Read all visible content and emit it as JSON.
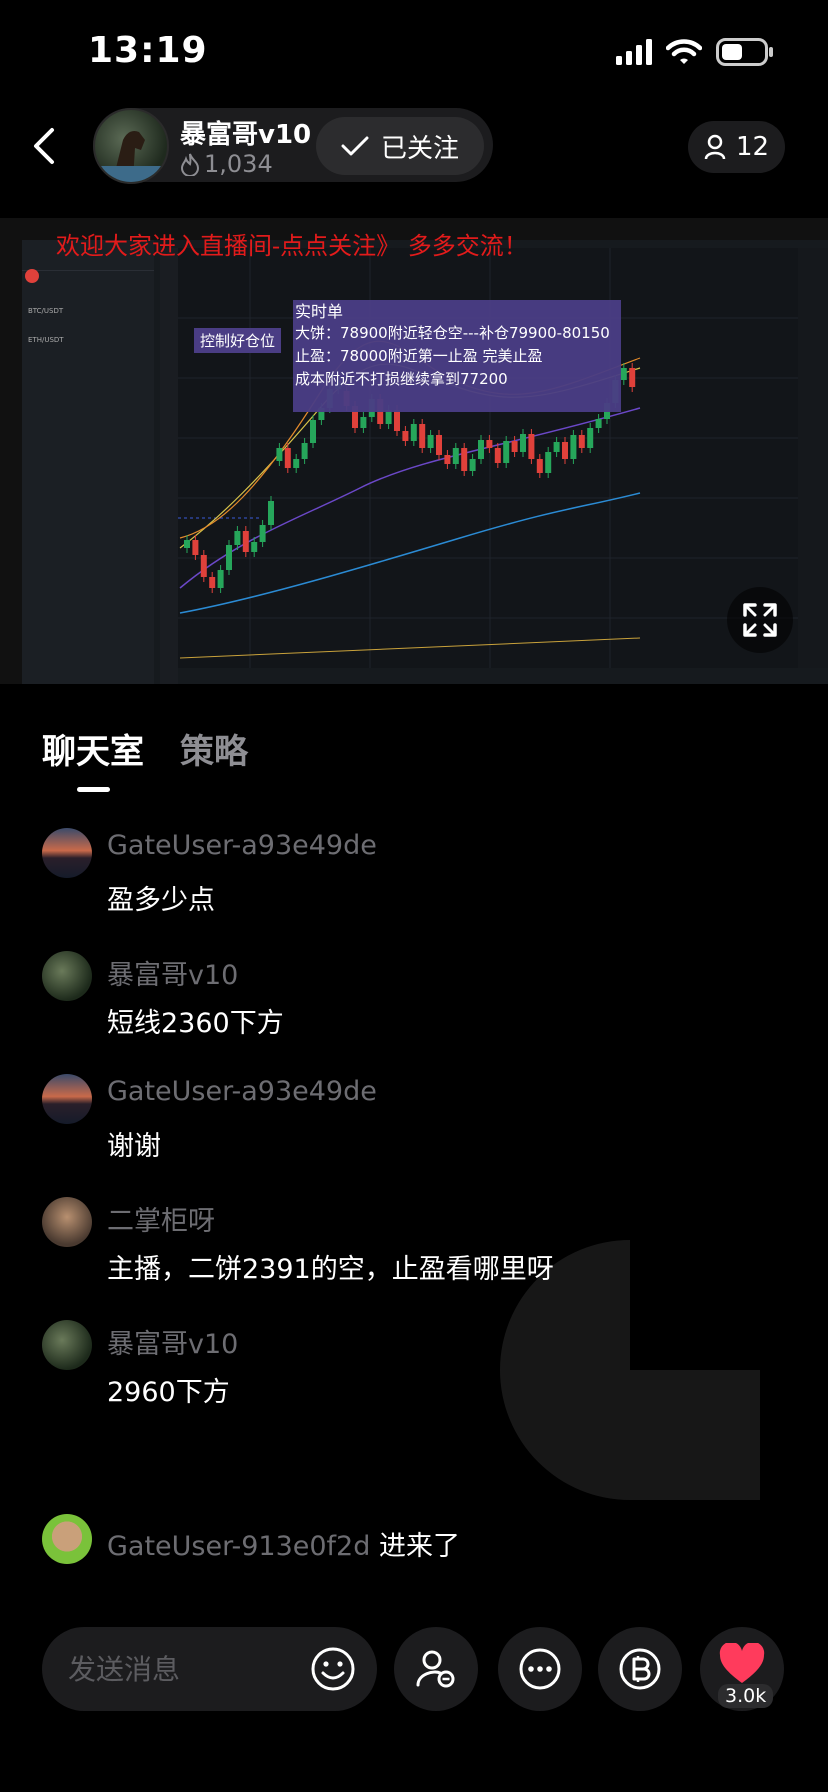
{
  "status_bar": {
    "time": "13:19",
    "icons": [
      "signal-icon",
      "wifi-icon",
      "battery-icon"
    ]
  },
  "header": {
    "host_name": "暴富哥v10",
    "heat": "1,034",
    "follow_label": "已关注",
    "viewers": "12"
  },
  "video": {
    "banner": "欢迎大家进入直播间-点点关注》 多多交流！",
    "overlay_box": {
      "title": "实时单",
      "line1": "大饼：78900附近轻仓空---补仓79900-80150",
      "line2": "止盈：78000附近第一止盈  完美止盈",
      "line3": "成本附近不打损继续拿到77200"
    },
    "side_label": "控制好仓位",
    "chart_type": "candlestick",
    "accent_up": "#26a65b",
    "accent_down": "#e0413b"
  },
  "tabs": [
    {
      "label": "聊天室",
      "active": true
    },
    {
      "label": "策略",
      "active": false
    }
  ],
  "chat": [
    {
      "user": "GateUser-a93e49de",
      "text": "盈多少点",
      "avatar": "mountain-avatar"
    },
    {
      "user": "暴富哥v10",
      "text": "短线2360下方",
      "avatar": "horse-avatar"
    },
    {
      "user": "GateUser-a93e49de",
      "text": "谢谢",
      "avatar": "mountain-avatar"
    },
    {
      "user": "二掌柜呀",
      "text": "主播，二饼2391的空，止盈看哪里呀",
      "avatar": "woman-avatar"
    },
    {
      "user": "暴富哥v10",
      "text": "2960下方",
      "avatar": "horse-avatar"
    }
  ],
  "enter_notice": {
    "user": "GateUser-913e0f2d",
    "text": "进来了"
  },
  "bottom_bar": {
    "placeholder": "发送消息",
    "like_count": "3.0k",
    "like_color": "#ff3b5c"
  }
}
